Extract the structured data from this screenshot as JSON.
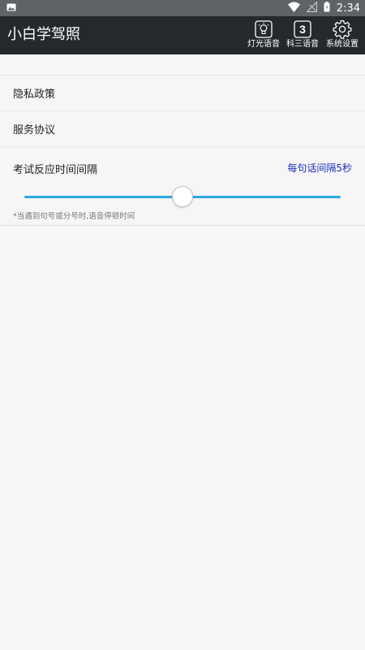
{
  "status_bar": {
    "time": "2:34",
    "icons": [
      "image-notification-icon",
      "wifi-icon",
      "no-signal-icon",
      "battery-icon"
    ]
  },
  "app_bar": {
    "title": "小白学驾照",
    "actions": [
      {
        "label": "灯光语音",
        "icon": "bulb-icon"
      },
      {
        "label": "科三语音",
        "icon": "number-3-icon",
        "icon_text": "3"
      },
      {
        "label": "系统设置",
        "icon": "gear-icon"
      }
    ]
  },
  "settings": {
    "items": [
      {
        "label": "隐私政策"
      },
      {
        "label": "服务协议"
      }
    ],
    "interval": {
      "label": "考试反应时间间隔",
      "value_text": "每句话间隔5秒",
      "note": "*当遇到句号或分号时,语音停顿时间",
      "slider_fraction": 0.5
    }
  },
  "colors": {
    "status_bar": "#5f6366",
    "app_bar": "#24292b",
    "background": "#f7f5f8",
    "accent_blue": "#1a2fb4",
    "slider": "#2aa8e0"
  }
}
